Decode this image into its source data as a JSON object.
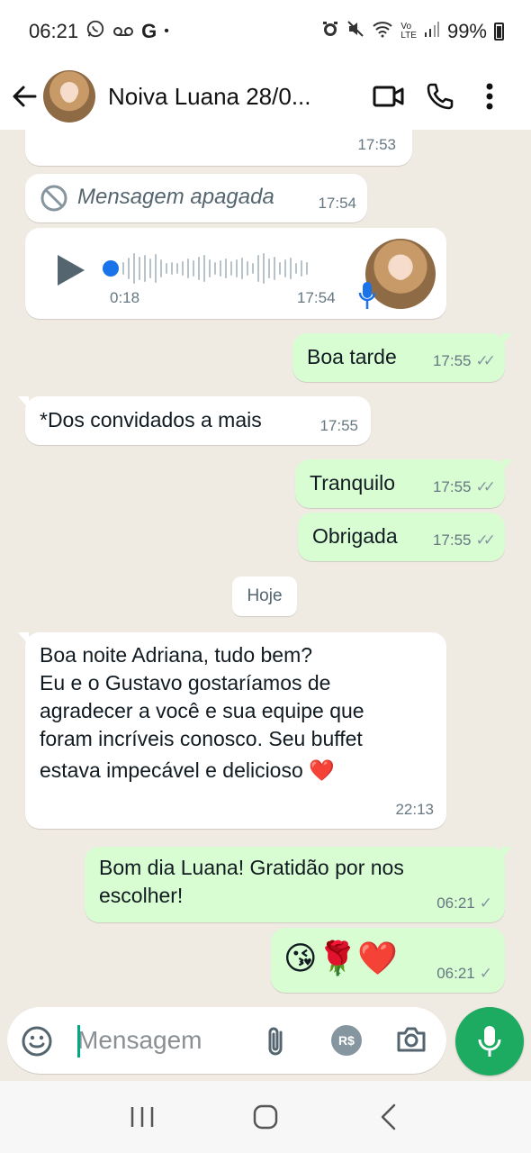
{
  "status_bar": {
    "time": "06:21",
    "battery": "99%",
    "left_icons": [
      "whatsapp-icon",
      "voicemail-icon",
      "google-icon",
      "dot-icon"
    ],
    "right_icons": [
      "alarm-icon",
      "mute-icon",
      "wifi-icon",
      "volte-icon",
      "signal-icon",
      "battery-icon"
    ]
  },
  "header": {
    "contact_name": "Noiva Luana 28/0...",
    "icons": [
      "back-arrow-icon",
      "video-call-icon",
      "phone-icon",
      "more-vert-icon"
    ]
  },
  "messages": [
    {
      "direction": "in",
      "text": "",
      "time": "17:53"
    },
    {
      "direction": "in",
      "deleted": true,
      "text": "Mensagem apagada",
      "time": "17:54"
    },
    {
      "direction": "in",
      "voice": true,
      "duration": "0:18",
      "time": "17:54"
    },
    {
      "direction": "out",
      "text": "Boa tarde",
      "time": "17:55",
      "status": "read"
    },
    {
      "direction": "in",
      "text": "*Dos convidados a mais",
      "time": "17:55"
    },
    {
      "direction": "out",
      "text": "Tranquilo",
      "time": "17:55",
      "status": "read"
    },
    {
      "direction": "out",
      "text": "Obrigada",
      "time": "17:55",
      "status": "read"
    },
    {
      "direction": "in",
      "lines": [
        "Boa noite Adriana, tudo bem?",
        "Eu e o Gustavo gostaríamos de",
        "agradecer a você e sua equipe que",
        "foram incríveis conosco. Seu buffet",
        "estava impecável e delicioso ❤️"
      ],
      "time": "22:13"
    },
    {
      "direction": "out",
      "lines": [
        "Bom dia Luana! Gratidão por nos",
        "escolher!"
      ],
      "time": "06:21",
      "status": "delivered"
    },
    {
      "direction": "out",
      "text": "😘🌹❤️",
      "time": "06:21",
      "status": "delivered"
    }
  ],
  "day_separator": "Hoje",
  "composer": {
    "placeholder": "Mensagem",
    "icons": [
      "emoji-icon",
      "attach-icon",
      "payment-icon",
      "camera-icon",
      "mic-icon"
    ],
    "payment_label": "R$"
  },
  "nav": {
    "icons": [
      "recents-icon",
      "home-icon",
      "back-icon"
    ]
  },
  "colors": {
    "outgoing_bubble": "#d9fdd3",
    "incoming_bubble": "#ffffff",
    "chat_bg": "#efeae2",
    "accent": "#1daa61",
    "voice_dot": "#1a73e8"
  }
}
